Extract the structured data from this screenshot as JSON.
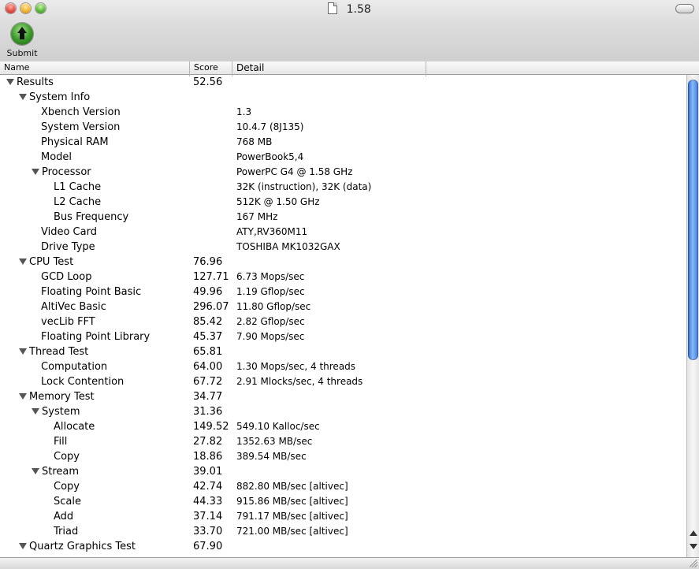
{
  "window": {
    "title": "1.58"
  },
  "toolbar": {
    "submit_label": "Submit"
  },
  "table": {
    "columns": {
      "name": "Name",
      "score": "Score",
      "detail": "Detail"
    },
    "rows": [
      {
        "name": "Results",
        "score": "52.56",
        "detail": "",
        "level": 0,
        "expanded": true
      },
      {
        "name": "System Info",
        "score": "",
        "detail": "",
        "level": 1,
        "expanded": true
      },
      {
        "name": "Xbench Version",
        "score": "",
        "detail": "1.3",
        "level": 2,
        "leaf": true
      },
      {
        "name": "System Version",
        "score": "",
        "detail": "10.4.7 (8J135)",
        "level": 2,
        "leaf": true
      },
      {
        "name": "Physical RAM",
        "score": "",
        "detail": "768 MB",
        "level": 2,
        "leaf": true
      },
      {
        "name": "Model",
        "score": "",
        "detail": "PowerBook5,4",
        "level": 2,
        "leaf": true
      },
      {
        "name": "Processor",
        "score": "",
        "detail": "PowerPC G4 @ 1.58 GHz",
        "level": 2,
        "expanded": true
      },
      {
        "name": "L1 Cache",
        "score": "",
        "detail": "32K (instruction), 32K (data)",
        "level": 3,
        "leaf": true
      },
      {
        "name": "L2 Cache",
        "score": "",
        "detail": "512K @ 1.50 GHz",
        "level": 3,
        "leaf": true
      },
      {
        "name": "Bus Frequency",
        "score": "",
        "detail": "167 MHz",
        "level": 3,
        "leaf": true
      },
      {
        "name": "Video Card",
        "score": "",
        "detail": "ATY,RV360M11",
        "level": 2,
        "leaf": true
      },
      {
        "name": "Drive Type",
        "score": "",
        "detail": "TOSHIBA MK1032GAX",
        "level": 2,
        "leaf": true
      },
      {
        "name": "CPU Test",
        "score": "76.96",
        "detail": "",
        "level": 1,
        "expanded": true
      },
      {
        "name": "GCD Loop",
        "score": "127.71",
        "detail": "6.73 Mops/sec",
        "level": 2,
        "leaf": true
      },
      {
        "name": "Floating Point Basic",
        "score": "49.96",
        "detail": "1.19 Gflop/sec",
        "level": 2,
        "leaf": true
      },
      {
        "name": "AltiVec Basic",
        "score": "296.07",
        "detail": "11.80 Gflop/sec",
        "level": 2,
        "leaf": true
      },
      {
        "name": "vecLib FFT",
        "score": "85.42",
        "detail": "2.82 Gflop/sec",
        "level": 2,
        "leaf": true
      },
      {
        "name": "Floating Point Library",
        "score": "45.37",
        "detail": "7.90 Mops/sec",
        "level": 2,
        "leaf": true
      },
      {
        "name": "Thread Test",
        "score": "65.81",
        "detail": "",
        "level": 1,
        "expanded": true
      },
      {
        "name": "Computation",
        "score": "64.00",
        "detail": "1.30 Mops/sec, 4 threads",
        "level": 2,
        "leaf": true
      },
      {
        "name": "Lock Contention",
        "score": "67.72",
        "detail": "2.91 Mlocks/sec, 4 threads",
        "level": 2,
        "leaf": true
      },
      {
        "name": "Memory Test",
        "score": "34.77",
        "detail": "",
        "level": 1,
        "expanded": true
      },
      {
        "name": "System",
        "score": "31.36",
        "detail": "",
        "level": 2,
        "expanded": true
      },
      {
        "name": "Allocate",
        "score": "149.52",
        "detail": "549.10 Kalloc/sec",
        "level": 3,
        "leaf": true
      },
      {
        "name": "Fill",
        "score": "27.82",
        "detail": "1352.63 MB/sec",
        "level": 3,
        "leaf": true
      },
      {
        "name": "Copy",
        "score": "18.86",
        "detail": "389.54 MB/sec",
        "level": 3,
        "leaf": true
      },
      {
        "name": "Stream",
        "score": "39.01",
        "detail": "",
        "level": 2,
        "expanded": true
      },
      {
        "name": "Copy",
        "score": "42.74",
        "detail": "882.80 MB/sec [altivec]",
        "level": 3,
        "leaf": true
      },
      {
        "name": "Scale",
        "score": "44.33",
        "detail": "915.86 MB/sec [altivec]",
        "level": 3,
        "leaf": true
      },
      {
        "name": "Add",
        "score": "37.14",
        "detail": "791.17 MB/sec [altivec]",
        "level": 3,
        "leaf": true
      },
      {
        "name": "Triad",
        "score": "33.70",
        "detail": "721.00 MB/sec [altivec]",
        "level": 3,
        "leaf": true
      },
      {
        "name": "Quartz Graphics Test",
        "score": "67.90",
        "detail": "",
        "level": 1,
        "expanded": true
      }
    ]
  },
  "colors": {
    "scroll_thumb": "#3a7ce0",
    "submit_green": "#3d9b2b"
  },
  "icons": {
    "submit": "up-arrow-circle-icon",
    "disclosure": "disclosure-triangle-icon",
    "document": "document-icon"
  }
}
